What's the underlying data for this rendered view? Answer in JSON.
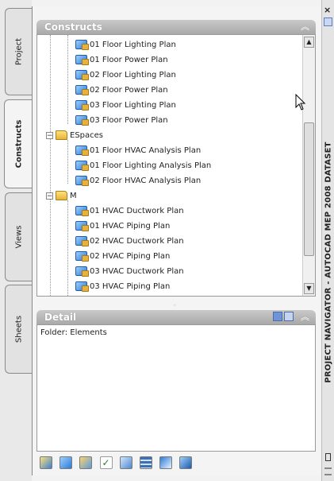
{
  "tabs": [
    {
      "label": "Project",
      "active": false
    },
    {
      "label": "Constructs",
      "active": true
    },
    {
      "label": "Views",
      "active": false
    },
    {
      "label": "Sheets",
      "active": false
    }
  ],
  "constructs": {
    "title": "Constructs",
    "tree": [
      {
        "kind": "item",
        "label": "01 Floor Lighting Plan"
      },
      {
        "kind": "item",
        "label": "01 Floor Power Plan"
      },
      {
        "kind": "item",
        "label": "02 Floor Lighting Plan"
      },
      {
        "kind": "item",
        "label": "02 Floor Power Plan"
      },
      {
        "kind": "item",
        "label": "03 Floor Lighting Plan"
      },
      {
        "kind": "item",
        "label": "03 Floor Power Plan"
      },
      {
        "kind": "folder",
        "label": "ESpaces"
      },
      {
        "kind": "item",
        "label": "01 Floor HVAC Analysis Plan"
      },
      {
        "kind": "item",
        "label": "01 Floor Lighting Analysis Plan"
      },
      {
        "kind": "item",
        "label": "02 Floor HVAC Analysis Plan"
      },
      {
        "kind": "folder",
        "label": "M"
      },
      {
        "kind": "item",
        "label": "01 HVAC Ductwork Plan"
      },
      {
        "kind": "item",
        "label": "01 HVAC Piping Plan"
      },
      {
        "kind": "item",
        "label": "02 HVAC Ductwork Plan"
      },
      {
        "kind": "item",
        "label": "02 HVAC Piping Plan"
      },
      {
        "kind": "item",
        "label": "03 HVAC Ductwork Plan"
      },
      {
        "kind": "item",
        "label": "03 HVAC Piping Plan"
      }
    ]
  },
  "detail": {
    "title": "Detail",
    "text": "Folder: Elements"
  },
  "toolbar_icons": [
    "add-construct-icon",
    "add-view-icon",
    "add-element-icon",
    "repath-icon",
    "refresh-icon",
    "table-icon",
    "regenerate-icon",
    "project-browser-icon"
  ],
  "window_title": "PROJECT NAVIGATOR - AUTOCAD MEP 2008 DATASET",
  "colors": {
    "title_bar": "#a9a9a9",
    "accent_blue": "#2d7bd8"
  }
}
